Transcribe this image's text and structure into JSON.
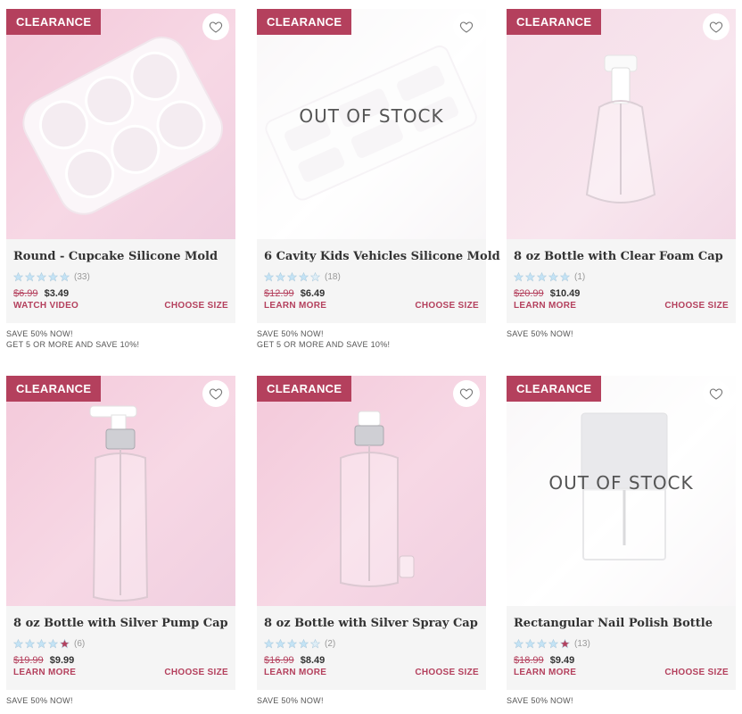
{
  "products": [
    {
      "badge": "CLEARANCE",
      "out_of_stock": "",
      "name": "Round - Cupcake Silicone Mold",
      "stars": 5,
      "rating_count": "(33)",
      "old_price": "$6.99",
      "new_price": "$3.49",
      "left_link": "WATCH VIDEO",
      "right_link": "CHOOSE SIZE",
      "promo1": "SAVE 50% NOW!",
      "promo2": "GET 5 OR MORE AND SAVE 10%!"
    },
    {
      "badge": "CLEARANCE",
      "out_of_stock": "OUT OF STOCK",
      "name": "6 Cavity Kids Vehicles Silicone Mold",
      "stars": 4.5,
      "rating_count": "(18)",
      "old_price": "$12.99",
      "new_price": "$6.49",
      "left_link": "LEARN MORE",
      "right_link": "CHOOSE SIZE",
      "promo1": "SAVE 50% NOW!",
      "promo2": "GET 5 OR MORE AND SAVE 10%!"
    },
    {
      "badge": "CLEARANCE",
      "out_of_stock": "",
      "name": "8 oz Bottle with Clear Foam Cap",
      "stars": 5,
      "rating_count": "(1)",
      "old_price": "$20.99",
      "new_price": "$10.49",
      "left_link": "LEARN MORE",
      "right_link": "CHOOSE SIZE",
      "promo1": "SAVE 50% NOW!",
      "promo2": ""
    },
    {
      "badge": "CLEARANCE",
      "out_of_stock": "",
      "name": "8 oz Bottle with Silver Pump Cap",
      "stars": 4,
      "rating_count": "(6)",
      "old_price": "$19.99",
      "new_price": "$9.99",
      "left_link": "LEARN MORE",
      "right_link": "CHOOSE SIZE",
      "promo1": "SAVE 50% NOW!",
      "promo2": ""
    },
    {
      "badge": "CLEARANCE",
      "out_of_stock": "",
      "name": "8 oz Bottle with Silver Spray Cap",
      "stars": 4.5,
      "rating_count": "(2)",
      "old_price": "$16.99",
      "new_price": "$8.49",
      "left_link": "LEARN MORE",
      "right_link": "CHOOSE SIZE",
      "promo1": "SAVE 50% NOW!",
      "promo2": ""
    },
    {
      "badge": "CLEARANCE",
      "out_of_stock": "OUT OF STOCK",
      "name": "Rectangular Nail Polish Bottle",
      "stars": 4,
      "rating_count": "(13)",
      "old_price": "$18.99",
      "new_price": "$9.49",
      "left_link": "LEARN MORE",
      "right_link": "CHOOSE SIZE",
      "promo1": "SAVE 50% NOW!",
      "promo2": ""
    }
  ],
  "colors": {
    "accent": "#b4405d",
    "star_fill": "#c4e3f5",
    "star_accent": "#b4405d",
    "card_bg": "#f5f5f5"
  },
  "icons": {
    "wishlist": "heart-icon",
    "rating": "star-icon"
  }
}
